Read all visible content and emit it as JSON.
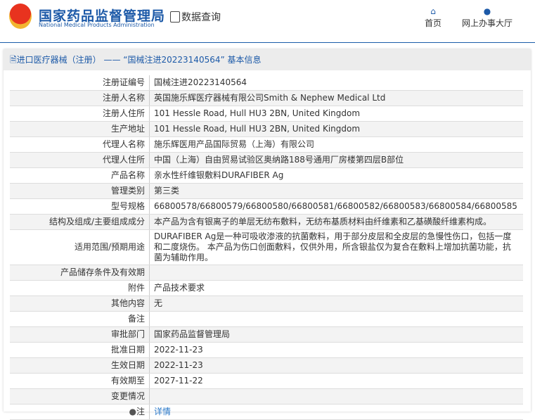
{
  "header": {
    "title_cn": "国家药品监督管理局",
    "title_en": "National Medical Products Administration",
    "query": "数据查询",
    "nav": [
      "首页",
      "网上办事大厅"
    ]
  },
  "panel": {
    "title": "进口医疗器械（注册） —— “国械注进20223140564” 基本信息"
  },
  "rows": [
    {
      "label": "注册证编号",
      "value": "国械注进20223140564"
    },
    {
      "label": "注册人名称",
      "value": "英国施乐辉医疗器械有限公司Smith & Nephew Medical Ltd"
    },
    {
      "label": "注册人住所",
      "value": "101 Hessle Road, Hull HU3 2BN, United Kingdom"
    },
    {
      "label": "生产地址",
      "value": "101 Hessle Road, Hull HU3 2BN, United Kingdom"
    },
    {
      "label": "代理人名称",
      "value": "施乐辉医用产品国际贸易（上海）有限公司"
    },
    {
      "label": "代理人住所",
      "value": "中国（上海）自由贸易试验区奥纳路188号通用厂房楼第四层B部位"
    },
    {
      "label": "产品名称",
      "value": "亲水性纤维银敷料DURAFIBER Ag"
    },
    {
      "label": "管理类别",
      "value": "第三类"
    },
    {
      "label": "型号规格",
      "value": "66800578/66800579/66800580/66800581/66800582/66800583/66800584/66800585"
    },
    {
      "label": "结构及组成/主要组成成分",
      "value": "本产品为含有银离子的单层无纺布敷料，无纺布基质材料由纤维素和乙基磺酸纤维素构成。"
    },
    {
      "label": "适用范围/预期用途",
      "value": "DURAFIBER Ag是一种可吸收渗液的抗菌敷料，用于部分皮层和全皮层的急慢性伤口，包括一度和二度烧伤。 本产品为伤口创面敷料，仅供外用，所含银盐仅为复合在敷料上增加抗菌功能，抗菌为辅助作用。"
    },
    {
      "label": "产品储存条件及有效期",
      "value": ""
    },
    {
      "label": "附件",
      "value": "产品技术要求"
    },
    {
      "label": "其他内容",
      "value": "无"
    },
    {
      "label": "备注",
      "value": ""
    },
    {
      "label": "审批部门",
      "value": "国家药品监督管理局"
    },
    {
      "label": "批准日期",
      "value": "2022-11-23"
    },
    {
      "label": "生效日期",
      "value": "2022-11-23"
    },
    {
      "label": "有效期至",
      "value": "2027-11-22"
    },
    {
      "label": "变更情况",
      "value": ""
    }
  ],
  "note": {
    "label": "注",
    "link": "详情"
  }
}
